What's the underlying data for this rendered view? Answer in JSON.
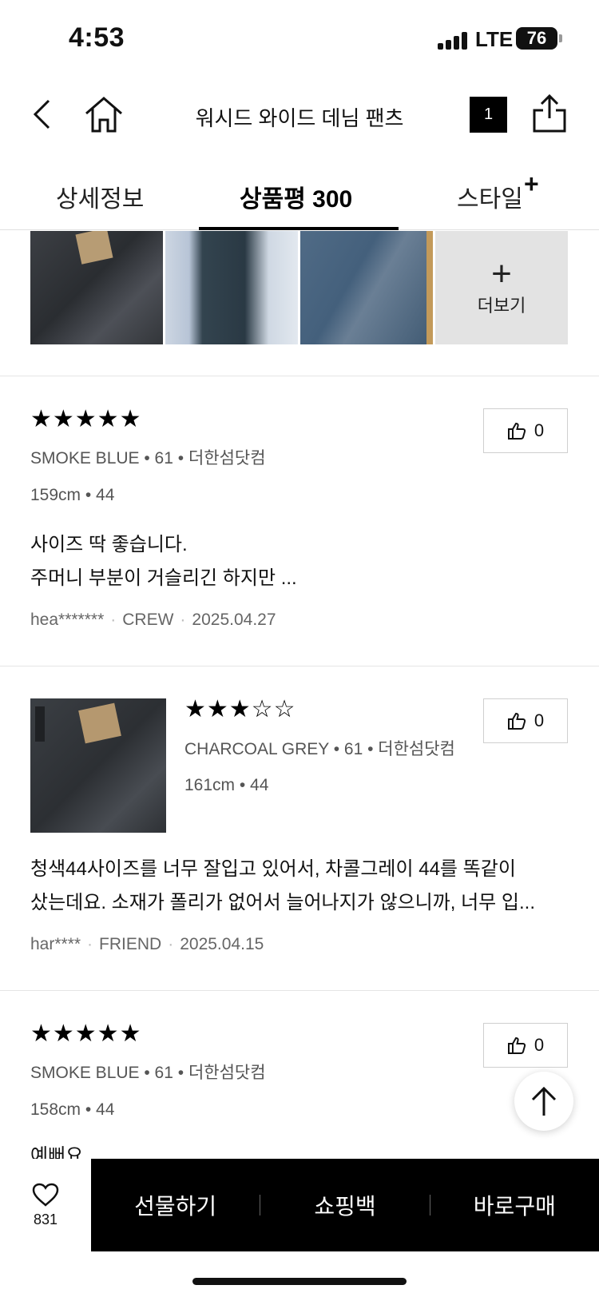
{
  "status": {
    "time": "4:53",
    "network": "LTE",
    "battery": "76"
  },
  "nav": {
    "title": "워시드 와이드 데님 팬츠",
    "cart_count": "1"
  },
  "tabs": {
    "detail": "상세정보",
    "review": "상품평 300",
    "style": "스타일",
    "style_plus": "+"
  },
  "photos": {
    "more_label": "더보기"
  },
  "reviews": [
    {
      "stars": "★★★★★",
      "variant": "SMOKE BLUE • 61 • 더한섬닷컴",
      "body": "159cm • 44",
      "text_line1": "사이즈 딱 좋습니다.",
      "text_line2": "주머니 부분이 거슬리긴 하지만 ...",
      "author": "hea*******",
      "tier": "CREW",
      "date": "2025.04.27",
      "likes": "0"
    },
    {
      "stars": "★★★☆☆",
      "variant": "CHARCOAL GREY • 61 • 더한섬닷컴",
      "body": "161cm • 44",
      "text_line1": "청색44사이즈를 너무 잘입고 있어서, 차콜그레이 44를 똑같이",
      "text_line2": "샀는데요. 소재가 폴리가 없어서 늘어나지가 않으니까,  너무 입...",
      "author": "har****",
      "tier": "FRIEND",
      "date": "2025.04.15",
      "likes": "0"
    },
    {
      "stars": "★★★★★",
      "variant": "SMOKE BLUE • 61 • 더한섬닷컴",
      "body": "158cm • 44",
      "text_line1": "예뻐요",
      "likes": "0"
    }
  ],
  "bottom": {
    "wish_count": "831",
    "gift": "선물하기",
    "cart": "쇼핑백",
    "buy": "바로구매"
  },
  "icons": [
    "back-icon",
    "home-icon",
    "share-icon",
    "thumbs-up-icon",
    "plus-icon",
    "arrow-up-icon",
    "heart-icon"
  ]
}
